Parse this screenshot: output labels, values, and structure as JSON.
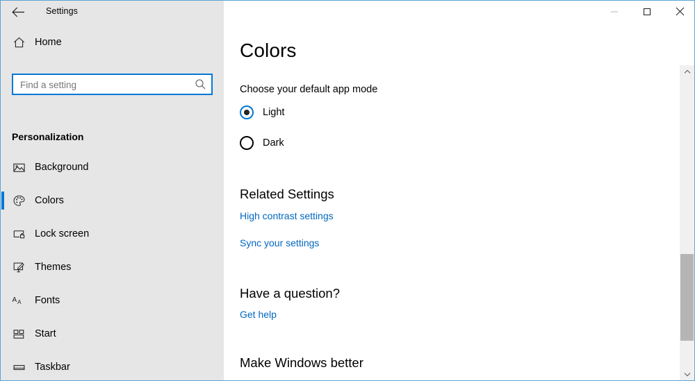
{
  "window": {
    "app_title": "Settings",
    "back_icon": "back-arrow-icon",
    "minimize_label": "Minimize",
    "maximize_label": "Maximize",
    "close_label": "Close",
    "accent_color": "#0078d7",
    "sidebar_bg": "#e6e6e6",
    "border_color": "#5ba3d8"
  },
  "sidebar": {
    "home": {
      "label": "Home",
      "icon": "home-icon"
    },
    "search": {
      "placeholder": "Find a setting",
      "value": "",
      "icon": "search-icon"
    },
    "group_title": "Personalization",
    "items": [
      {
        "label": "Background",
        "icon": "image-icon",
        "selected": false
      },
      {
        "label": "Colors",
        "icon": "palette-icon",
        "selected": true
      },
      {
        "label": "Lock screen",
        "icon": "lock-screen-icon",
        "selected": false
      },
      {
        "label": "Themes",
        "icon": "paintbrush-icon",
        "selected": false
      },
      {
        "label": "Fonts",
        "icon": "fonts-icon",
        "selected": false
      },
      {
        "label": "Start",
        "icon": "start-tiles-icon",
        "selected": false
      },
      {
        "label": "Taskbar",
        "icon": "taskbar-icon",
        "selected": false
      }
    ]
  },
  "content": {
    "page_title": "Colors",
    "app_mode": {
      "label": "Choose your default app mode",
      "options": [
        {
          "label": "Light",
          "selected": true
        },
        {
          "label": "Dark",
          "selected": false
        }
      ]
    },
    "related_settings": {
      "heading": "Related Settings",
      "links": [
        {
          "label": "High contrast settings"
        },
        {
          "label": "Sync your settings"
        }
      ]
    },
    "have_a_question": {
      "heading": "Have a question?",
      "links": [
        {
          "label": "Get help"
        }
      ]
    },
    "make_windows_better": {
      "heading": "Make Windows better"
    }
  },
  "scrollbar": {
    "up_icon": "chevron-up-icon",
    "down_icon": "chevron-down-icon"
  }
}
